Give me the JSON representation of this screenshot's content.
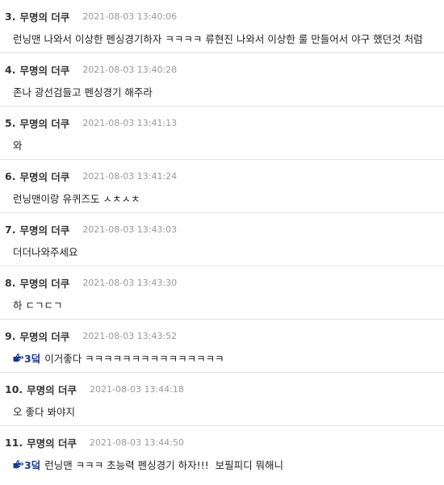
{
  "comments": [
    {
      "num": "3.",
      "author": "무명의 더쿠",
      "date": "2021-08-03 13:40:06",
      "reply_ref": "",
      "text": "런닝맨 나와서 이상한 펜싱경기하자 ㅋㅋㅋㅋ 류현진 나와서 이상한 룰 만들어서 야구 했던것 처럼"
    },
    {
      "num": "4.",
      "author": "무명의 더쿠",
      "date": "2021-08-03 13:40:28",
      "reply_ref": "",
      "text": "존나 광선검들고 펜싱경기 해주라"
    },
    {
      "num": "5.",
      "author": "무명의 더쿠",
      "date": "2021-08-03 13:41:13",
      "reply_ref": "",
      "text": "와"
    },
    {
      "num": "6.",
      "author": "무명의 더쿠",
      "date": "2021-08-03 13:41:24",
      "reply_ref": "",
      "text": "런닝맨이랑 유퀴즈도 ㅅㅊㅅㅊ"
    },
    {
      "num": "7.",
      "author": "무명의 더쿠",
      "date": "2021-08-03 13:43:03",
      "reply_ref": "",
      "text": "더더나와주세요"
    },
    {
      "num": "8.",
      "author": "무명의 더쿠",
      "date": "2021-08-03 13:43:30",
      "reply_ref": "",
      "text": "하 ㄷㄱㄷㄱ"
    },
    {
      "num": "9.",
      "author": "무명의 더쿠",
      "date": "2021-08-03 13:43:52",
      "reply_ref": "3덬",
      "text": "이거좋다 ㅋㅋㅋㅋㅋㅋㅋㅋㅋㅋㅋㅋㅋㅋㅋ"
    },
    {
      "num": "10.",
      "author": "무명의 더쿠",
      "date": "2021-08-03 13:44:18",
      "reply_ref": "",
      "text": "오 좋다 봐야지"
    },
    {
      "num": "11.",
      "author": "무명의 더쿠",
      "date": "2021-08-03 13:44:50",
      "reply_ref": "3덬",
      "text": "런닝맨 ㅋㅋㅋ 초능력 펜싱경기 하자!!!  보필피디 뭐해니"
    }
  ],
  "colors": {
    "reply_ref": "#1a3b8a",
    "date": "#999999",
    "divider": "#e2e2e2"
  },
  "icons": {
    "reply_ref": "pointing-hand-icon"
  }
}
